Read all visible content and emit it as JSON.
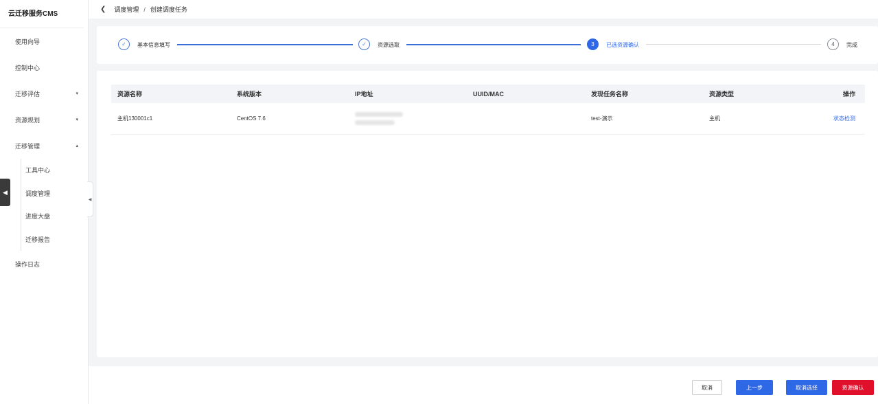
{
  "app": {
    "title": "云迁移服务CMS"
  },
  "sidebar": {
    "items": [
      {
        "label": "使用向导",
        "caret": ""
      },
      {
        "label": "控制中心",
        "caret": ""
      },
      {
        "label": "迁移评估",
        "caret": "▾"
      },
      {
        "label": "资源规划",
        "caret": "▾"
      },
      {
        "label": "迁移管理",
        "caret": "▴"
      }
    ],
    "sub_items": [
      {
        "label": "工具中心"
      },
      {
        "label": "调度管理"
      },
      {
        "label": "进度大盘"
      },
      {
        "label": "迁移报告"
      }
    ],
    "footer_item": {
      "label": "操作日志"
    }
  },
  "breadcrumb": {
    "parent": "调度管理",
    "separator": "/",
    "current": "创建调度任务"
  },
  "steps": [
    {
      "num": "✓",
      "label": "基本信息填写",
      "state": "done"
    },
    {
      "num": "✓",
      "label": "资源选取",
      "state": "done"
    },
    {
      "num": "3",
      "label": "已选资源确认",
      "state": "active"
    },
    {
      "num": "4",
      "label": "完成",
      "state": "pending"
    }
  ],
  "table": {
    "headers": [
      "资源名称",
      "系统版本",
      "IP地址",
      "UUID/MAC",
      "发现任务名称",
      "资源类型",
      "操作"
    ],
    "rows": [
      {
        "name": "主机130001c1",
        "os": "CentOS 7.6",
        "ip": "",
        "uuid": "",
        "task": "test-演示",
        "type": "主机",
        "action": "状态检测"
      }
    ]
  },
  "footer": {
    "cancel": "取消",
    "prev": "上一步",
    "deselect": "取消选择",
    "confirm": "资源确认"
  },
  "colors": {
    "primary": "#2f68e6",
    "danger": "#e0102b"
  }
}
